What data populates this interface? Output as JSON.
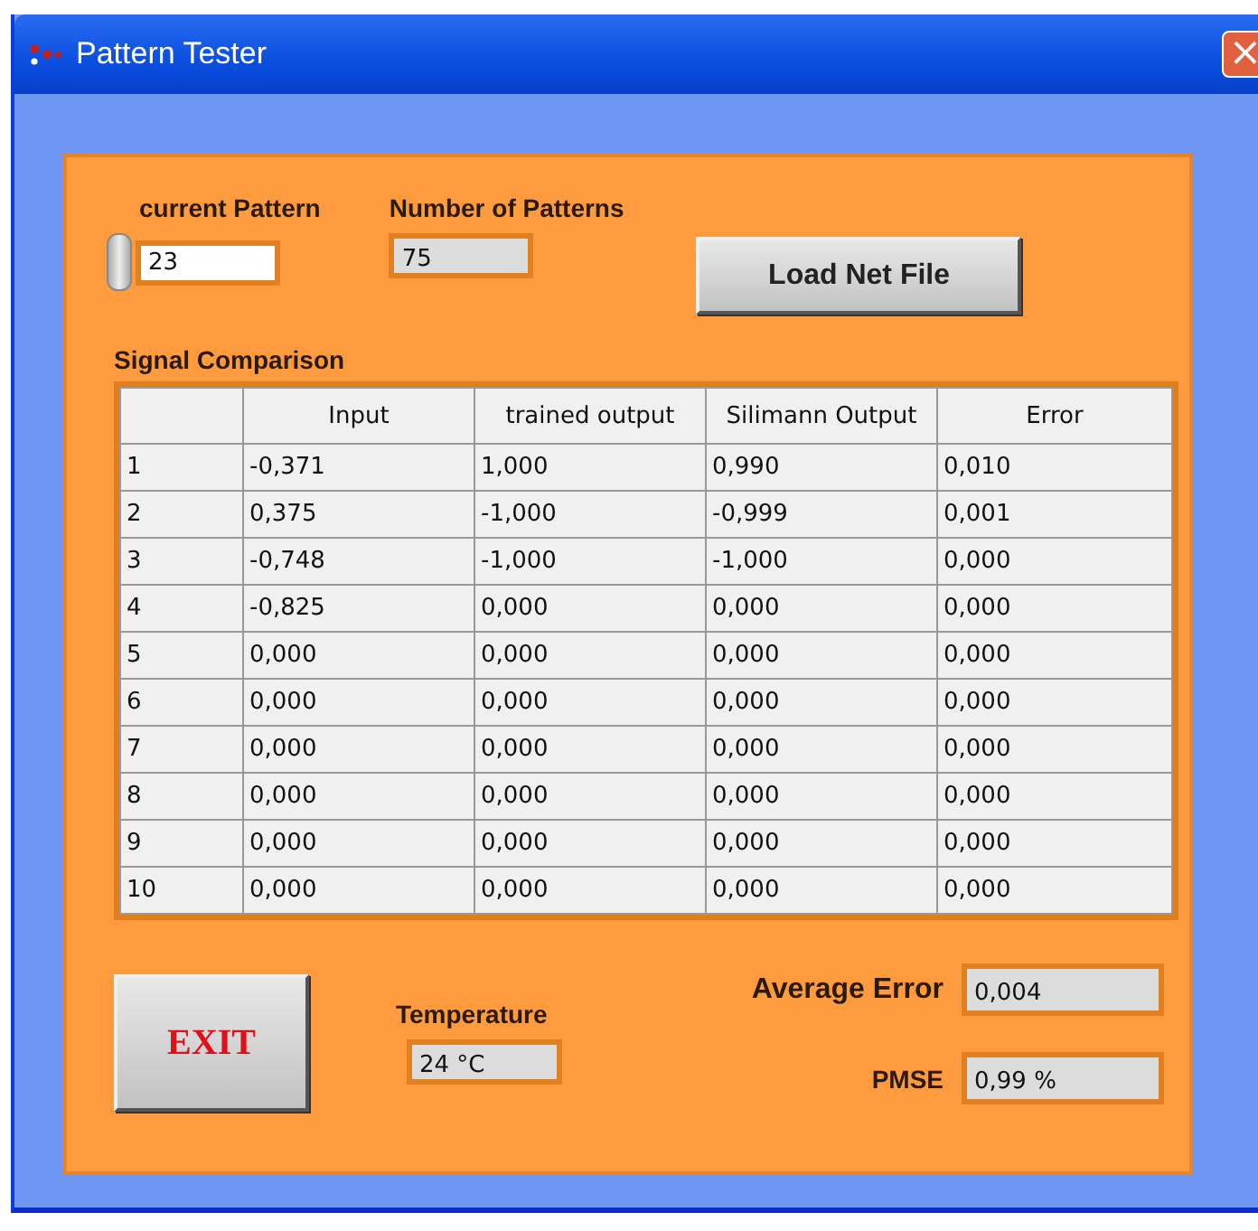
{
  "window": {
    "title": "Pattern Tester",
    "close": "×"
  },
  "current_pattern": {
    "label": "current Pattern",
    "value": "23"
  },
  "number_of_patterns": {
    "label": "Number of Patterns",
    "value": "75"
  },
  "load_button": "Load Net File",
  "table": {
    "title": "Signal Comparison",
    "columns": [
      "",
      "Input",
      "trained output",
      "Silimann Output",
      "Error"
    ],
    "rows": [
      [
        "1",
        "-0,371",
        "1,000",
        "0,990",
        "0,010"
      ],
      [
        "2",
        "0,375",
        "-1,000",
        "-0,999",
        "0,001"
      ],
      [
        "3",
        "-0,748",
        "-1,000",
        "-1,000",
        "0,000"
      ],
      [
        "4",
        "-0,825",
        "0,000",
        "0,000",
        "0,000"
      ],
      [
        "5",
        "0,000",
        "0,000",
        "0,000",
        "0,000"
      ],
      [
        "6",
        "0,000",
        "0,000",
        "0,000",
        "0,000"
      ],
      [
        "7",
        "0,000",
        "0,000",
        "0,000",
        "0,000"
      ],
      [
        "8",
        "0,000",
        "0,000",
        "0,000",
        "0,000"
      ],
      [
        "9",
        "0,000",
        "0,000",
        "0,000",
        "0,000"
      ],
      [
        "10",
        "0,000",
        "0,000",
        "0,000",
        "0,000"
      ]
    ]
  },
  "exit_button": "EXIT",
  "temperature": {
    "label": "Temperature",
    "value": "24 °C"
  },
  "average_error": {
    "label": "Average Error",
    "value": "0,004"
  },
  "pmse": {
    "label": "PMSE",
    "value": "0,99 %"
  }
}
